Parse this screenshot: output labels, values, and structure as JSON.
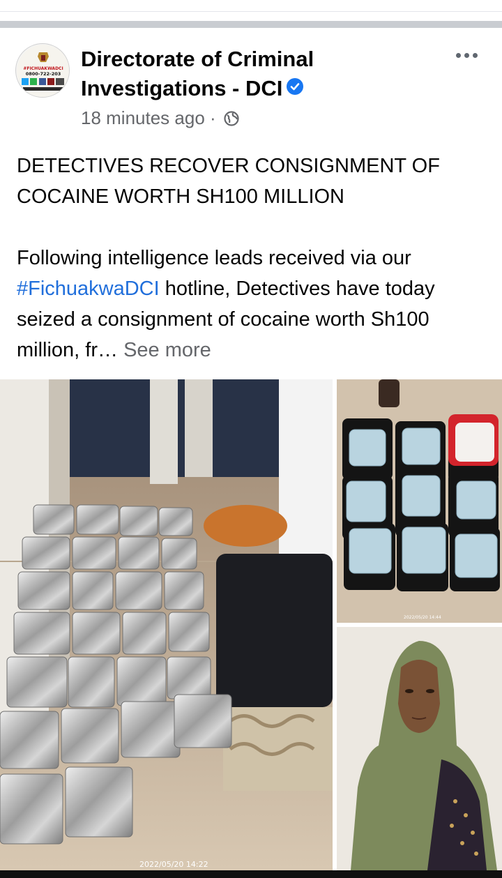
{
  "post": {
    "author": "Directorate of Criminal Investigations - DCI",
    "timestamp": "18 minutes ago",
    "separator": "·",
    "headline": "DETECTIVES RECOVER CONSIGNMENT OF COCAINE WORTH SH100 MILLION",
    "body_before_tag": "Following intelligence leads received via our ",
    "hashtag": "#FichuakwaDCI",
    "body_after_tag": " hotline, Detectives have today seized a consignment of cocaine worth Sh100 million, fr…",
    "see_more": "See more"
  },
  "avatar": {
    "hashtag": "#FICHUAKWADCI",
    "phone": "0800-722-203"
  },
  "photos": {
    "main_stamp": "2022/05/20 14:22",
    "right_top_stamp": "2022/05/20 14:44"
  },
  "icons": {
    "verified": "verified-badge-icon",
    "globe": "public-globe-icon",
    "more": "more-options-icon"
  },
  "colors": {
    "link": "#216fdb",
    "secondary_text": "#65676b",
    "verified": "#1877f2"
  }
}
